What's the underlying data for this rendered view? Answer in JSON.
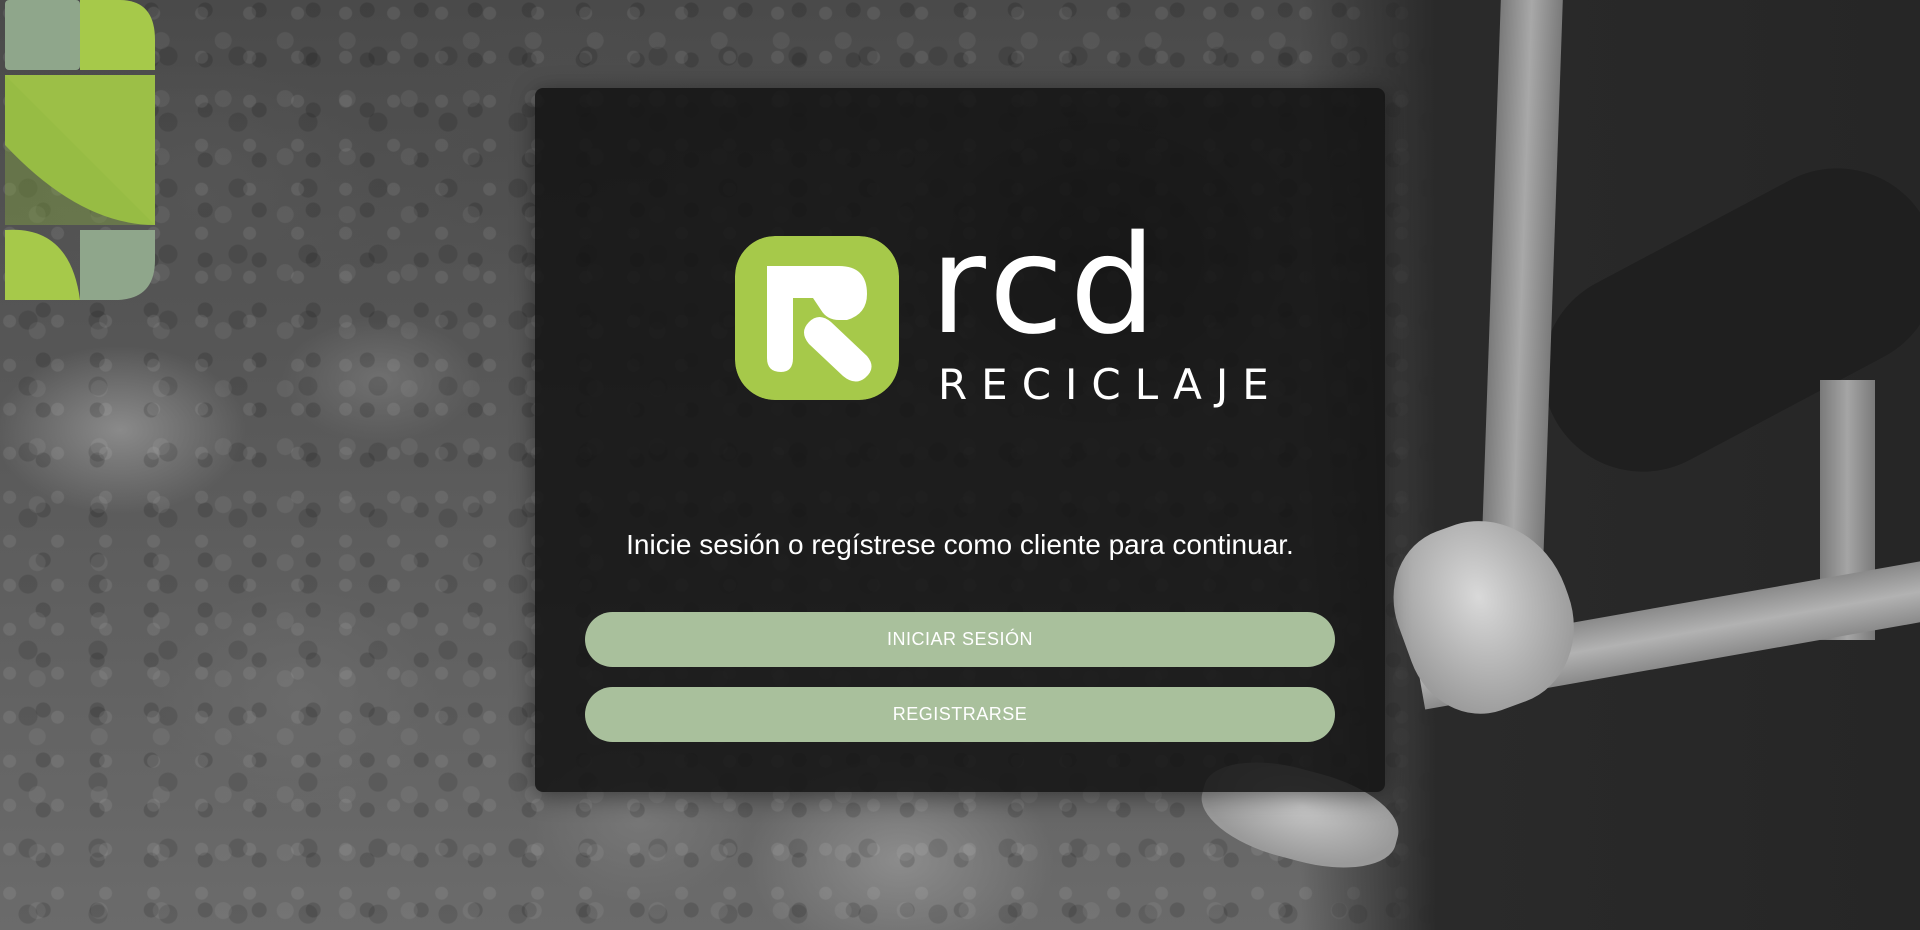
{
  "background": {
    "description_icon": "photo-background",
    "tone": "grayscale"
  },
  "decoration": {
    "icon": "leaf-tiles-icon",
    "colors": {
      "lime": "#a6c94a",
      "sage": "#8fa68b"
    }
  },
  "card": {
    "logo": {
      "icon": "rcd-logo-mark-icon",
      "brand_color": "#a6c94a",
      "word": "rcd",
      "subtitle": "RECICLAJE"
    },
    "prompt": "Inicie sesión o regístrese como cliente para continuar.",
    "buttons": {
      "login_label": "INICIAR SESIÓN",
      "register_label": "REGISTRARSE"
    },
    "button_color": "#a9c09c"
  }
}
